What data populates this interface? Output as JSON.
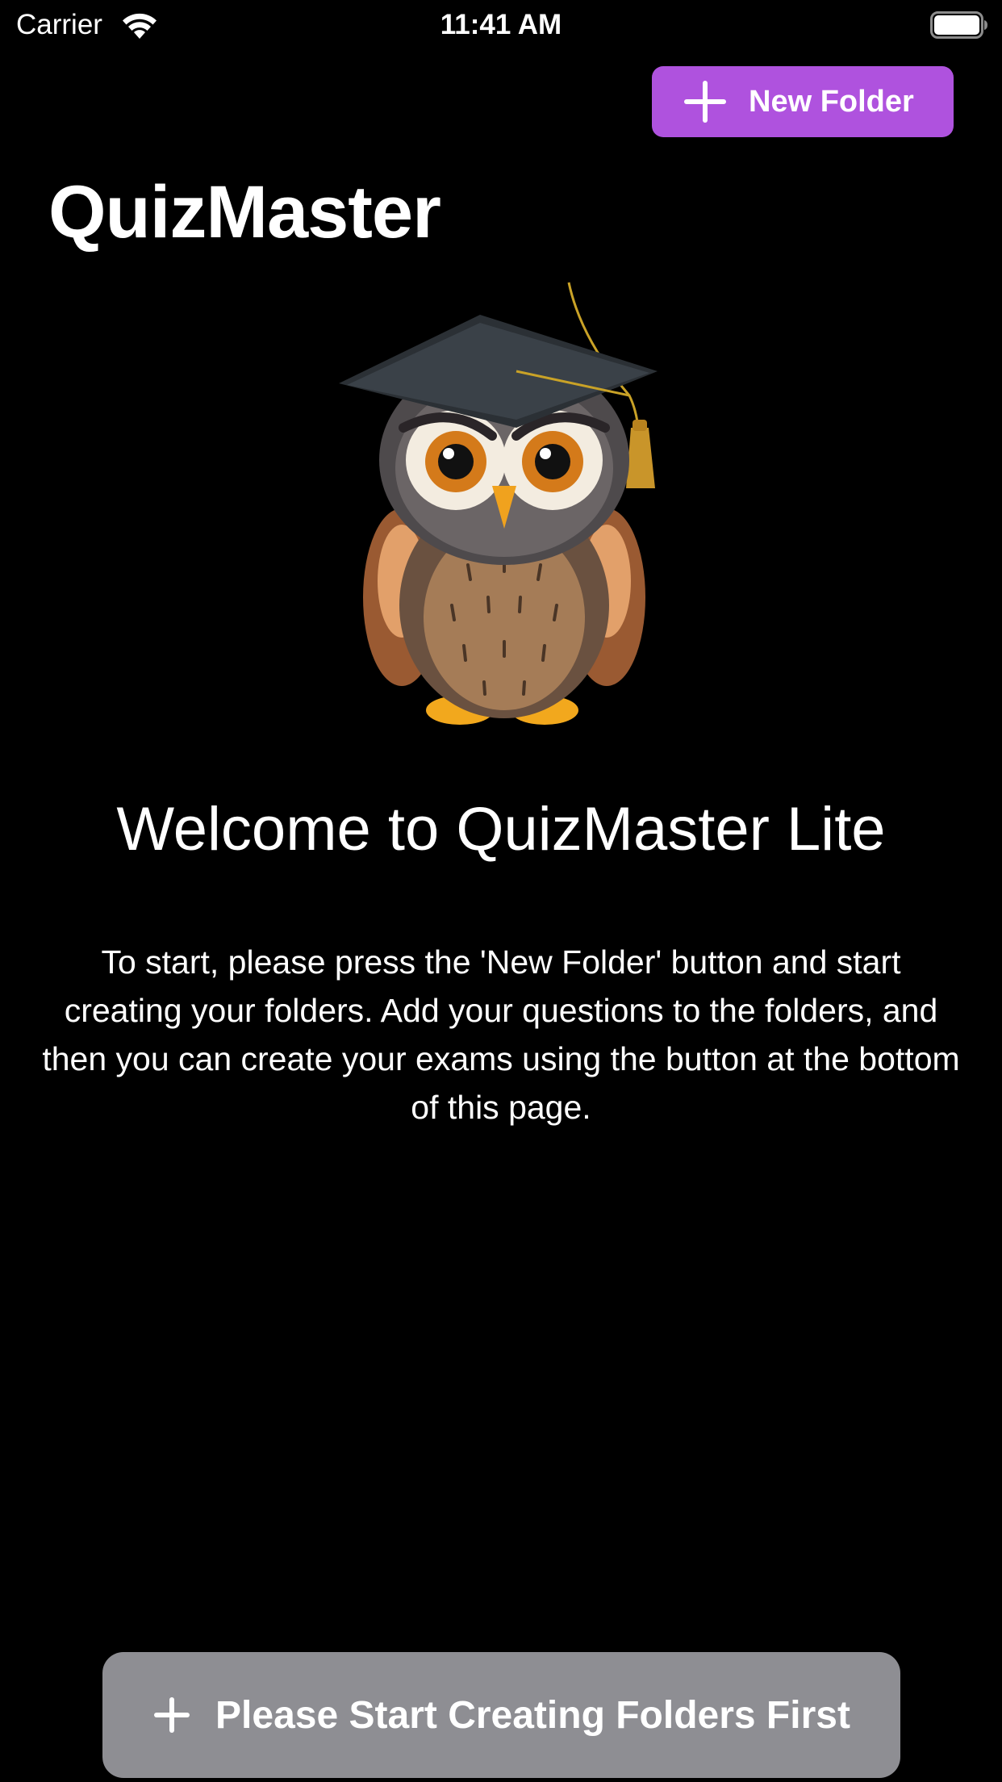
{
  "status_bar": {
    "carrier": "Carrier",
    "time": "11:41 AM",
    "wifi_icon": "wifi-icon",
    "battery_icon": "battery-full-icon"
  },
  "toolbar": {
    "new_folder_label": "New Folder",
    "new_folder_icon": "plus-icon",
    "accent_color": "#af52de"
  },
  "header": {
    "title": "QuizMaster"
  },
  "mascot": {
    "icon": "owl-graduate-icon"
  },
  "welcome": {
    "heading": "Welcome to QuizMaster Lite",
    "instructions": "To start, please press the 'New Folder' button and start creating your folders. Add your questions to the folders, and then you can create your exams using the button at the bottom of this page."
  },
  "bottom_action": {
    "label": "Please Start Creating Folders First",
    "icon": "plus-icon",
    "state": "disabled",
    "color": "#8e8e93"
  }
}
